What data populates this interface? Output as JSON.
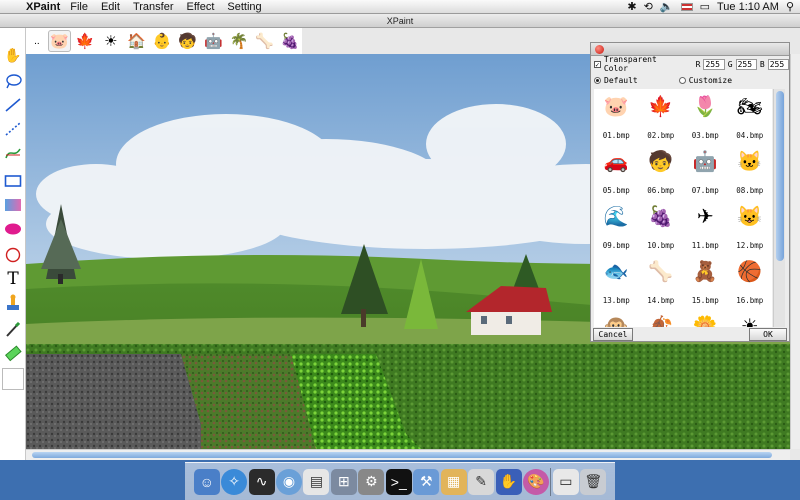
{
  "menubar": {
    "apple": "",
    "app": "XPaint",
    "items": [
      "File",
      "Edit",
      "Transfer",
      "Effect",
      "Setting"
    ],
    "clock": "Tue 1:10 AM"
  },
  "window": {
    "title": "XPaint"
  },
  "stampbar": {
    "more": "..",
    "stamps": [
      "pig-head",
      "maple-leaf",
      "sun",
      "house",
      "baby",
      "kid",
      "robot",
      "palm-tree",
      "bone",
      "grapes"
    ]
  },
  "panel": {
    "transparent_label": "Transparent Color",
    "r_label": "R",
    "r_value": "255",
    "g_label": "G",
    "g_value": "255",
    "b_label": "B",
    "b_value": "255",
    "default_label": "Default",
    "customize_label": "Customize",
    "cancel_label": "Cancel",
    "ok_label": "OK",
    "items": [
      {
        "label": "01.bmp",
        "icon": "🐷"
      },
      {
        "label": "02.bmp",
        "icon": "🍁"
      },
      {
        "label": "03.bmp",
        "icon": "🌷"
      },
      {
        "label": "04.bmp",
        "icon": "🏍"
      },
      {
        "label": "05.bmp",
        "icon": "🚗"
      },
      {
        "label": "06.bmp",
        "icon": "🧒"
      },
      {
        "label": "07.bmp",
        "icon": "🤖"
      },
      {
        "label": "08.bmp",
        "icon": "🐱"
      },
      {
        "label": "09.bmp",
        "icon": "🌊"
      },
      {
        "label": "10.bmp",
        "icon": "🍇"
      },
      {
        "label": "11.bmp",
        "icon": "✈"
      },
      {
        "label": "12.bmp",
        "icon": "😺"
      },
      {
        "label": "13.bmp",
        "icon": "🐟"
      },
      {
        "label": "14.bmp",
        "icon": "🦴"
      },
      {
        "label": "15.bmp",
        "icon": "🧸"
      },
      {
        "label": "16.bmp",
        "icon": "🏀"
      },
      {
        "label": "",
        "icon": "🐵"
      },
      {
        "label": "",
        "icon": "🍂"
      },
      {
        "label": "",
        "icon": "🌼"
      },
      {
        "label": "",
        "icon": "☀"
      }
    ]
  },
  "colors": {
    "accent": "#3d6fb0",
    "close": "#d0241a"
  }
}
